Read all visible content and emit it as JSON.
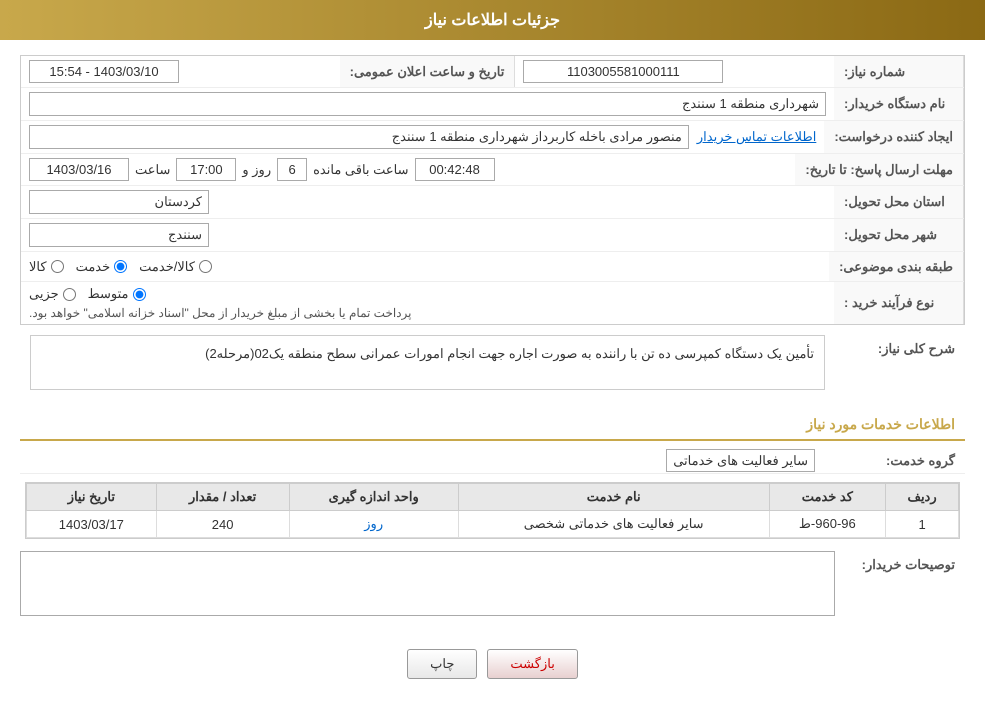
{
  "header": {
    "title": "جزئیات اطلاعات نیاز"
  },
  "fields": {
    "shomara_niaz_label": "شماره نیاز:",
    "shomara_niaz_value": "1103005581000111",
    "nam_dastgah_label": "نام دستگاه خریدار:",
    "nam_dastgah_value": "شهرداری منطقه 1 سنندج",
    "ijad_label": "ایجاد کننده درخواست:",
    "ijad_value": "منصور مرادی باخله کاربرداز شهرداری منطقه 1 سنندج",
    "ijad_link": "اطلاعات تماس خریدار",
    "tarikh_label": "تاریخ و ساعت اعلان عمومی:",
    "tarikh_value": "1403/03/10 - 15:54",
    "mohlet_label": "مهلت ارسال پاسخ: تا تاریخ:",
    "mohlet_date": "1403/03/16",
    "mohlet_saet_label": "ساعت",
    "mohlet_saet": "17:00",
    "mohlet_rouz_label": "روز و",
    "mohlet_rouz": "6",
    "mohlet_baqi_label": "ساعت باقی مانده",
    "mohlet_baqi": "00:42:48",
    "ostan_label": "استان محل تحویل:",
    "ostan_value": "کردستان",
    "shahr_label": "شهر محل تحویل:",
    "shahr_value": "سنندج",
    "tabaqe_label": "طبقه بندی موضوعی:",
    "tabaqe_options": [
      {
        "id": "kala",
        "label": "کالا"
      },
      {
        "id": "khedmat",
        "label": "خدمت"
      },
      {
        "id": "kala_khedmat",
        "label": "کالا/خدمت"
      }
    ],
    "tabaqe_selected": "khedmat",
    "faraiand_label": "نوع فرآیند خرید :",
    "faraiand_options": [
      {
        "id": "jozii",
        "label": "جزیی"
      },
      {
        "id": "motavaset",
        "label": "متوسط"
      }
    ],
    "faraiand_selected": "motavaset",
    "faraiand_note": "پرداخت تمام یا بخشی از مبلغ خریدار از محل \"اسناد خزانه اسلامی\" خواهد بود.",
    "sharh_label": "شرح کلی نیاز:",
    "sharh_value": "تأمین یک دستگاه کمپرسی ده تن با راننده به صورت اجاره جهت انجام امورات عمرانی سطح منطقه یک02(مرحله2)",
    "services_title": "اطلاعات خدمات مورد نیاز",
    "grouh_label": "گروه خدمت:",
    "grouh_value": "سایر فعالیت های خدماتی",
    "table": {
      "headers": [
        "ردیف",
        "کد خدمت",
        "نام خدمت",
        "واحد اندازه گیری",
        "تعداد / مقدار",
        "تاریخ نیاز"
      ],
      "rows": [
        {
          "radif": "1",
          "kod_khedmat": "960-96-ط",
          "nam_khedmat": "سایر فعالیت های خدماتی شخصی",
          "vahed": "روز",
          "tedad": "240",
          "tarikh": "1403/03/17"
        }
      ]
    },
    "tosif_label": "توصیحات خریدار:",
    "tosif_value": "",
    "btn_print": "چاپ",
    "btn_back": "بازگشت"
  }
}
